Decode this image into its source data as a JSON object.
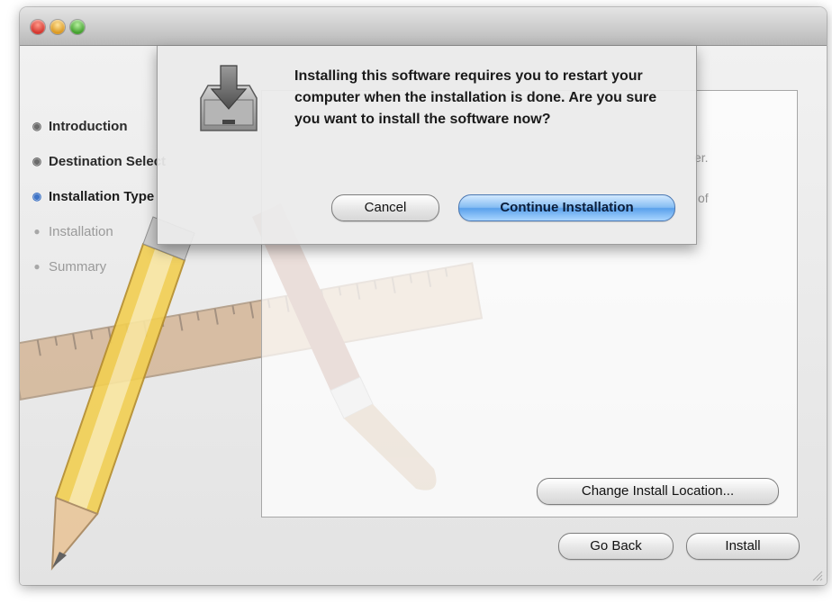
{
  "window": {
    "title": ""
  },
  "sidebar": {
    "steps": [
      {
        "label": "Introduction",
        "state": "done"
      },
      {
        "label": "Destination Select",
        "state": "done"
      },
      {
        "label": "Installation Type",
        "state": "current"
      },
      {
        "label": "Installation",
        "state": "pending"
      },
      {
        "label": "Summary",
        "state": "pending"
      }
    ]
  },
  "panel": {
    "lines": [
      "er.",
      "of"
    ]
  },
  "buttons": {
    "change_location": "Change Install Location...",
    "go_back": "Go Back",
    "install": "Install"
  },
  "dialog": {
    "message": "Installing this software requires you to restart your computer when the installation is done. Are you sure you want to install the software now?",
    "cancel": "Cancel",
    "continue": "Continue Installation",
    "icon": "installer-package-icon"
  },
  "colors": {
    "accent_blue": "#5aa1eb",
    "step_current": "#3f74c7",
    "window_bg": "#e7e7e7"
  }
}
